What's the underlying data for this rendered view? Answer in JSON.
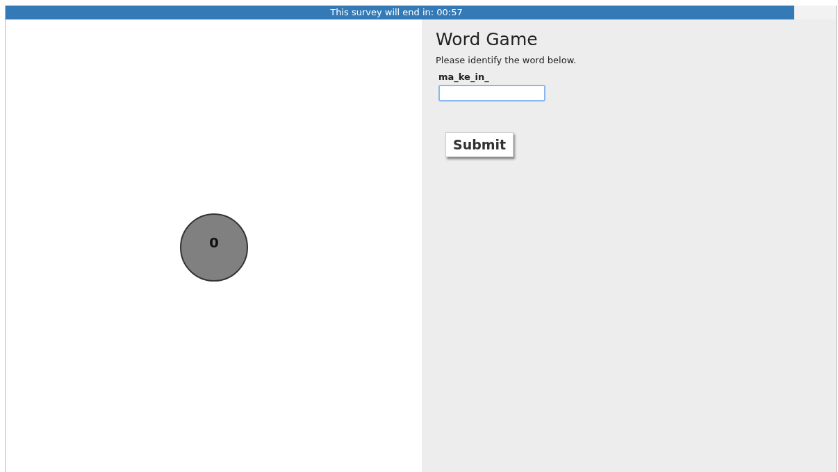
{
  "timer_bar": {
    "text": "This survey will end in: 00:57",
    "level": 0.95
  },
  "counter": {
    "value": "0"
  },
  "game": {
    "title": "Word Game",
    "instruction": "Please identify the word below.",
    "word": "ma_ke_in_"
  },
  "buttons": [
    "Submit"
  ]
}
